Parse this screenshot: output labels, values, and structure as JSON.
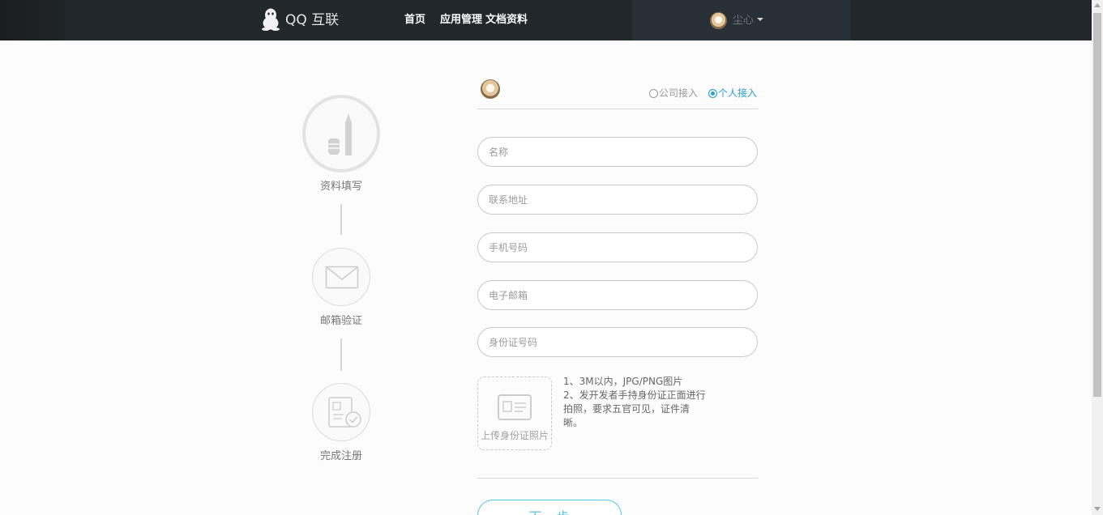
{
  "colors": {
    "header_bg": "#22272b",
    "accent_blue": "#2aa1d3",
    "button_cyan": "#52c7df",
    "step_border": "#e3e3e3"
  },
  "header": {
    "logo_icon": "qq-penguin-icon",
    "logo_text": "QQ 互联",
    "nav": [
      {
        "label": "首页"
      },
      {
        "label": "应用管理"
      },
      {
        "label": "文档资料"
      }
    ],
    "user": {
      "name": "尘心",
      "menu_icon": "caret-down-icon"
    }
  },
  "steps": [
    {
      "label": "资料填写",
      "icon": "pen-eraser-icon",
      "active": true
    },
    {
      "label": "邮箱验证",
      "icon": "envelope-icon",
      "active": false
    },
    {
      "label": "完成注册",
      "icon": "id-card-check-icon",
      "active": false
    }
  ],
  "form": {
    "access_type": [
      {
        "label": "公司接入",
        "selected": false
      },
      {
        "label": "个人接入",
        "selected": true
      }
    ],
    "fields": [
      {
        "placeholder": "名称"
      },
      {
        "placeholder": "联系地址"
      },
      {
        "placeholder": "手机号码"
      },
      {
        "placeholder": "电子邮箱"
      },
      {
        "placeholder": "身份证号码"
      }
    ],
    "upload": {
      "icon": "id-card-icon",
      "label": "上传身份证照片",
      "notes": [
        "1、3M以内，JPG/PNG图片",
        "2、发开发者手持身份证正面进行",
        "拍照，要求五官可见，证件清",
        "晰。"
      ]
    },
    "submit_label": "下一步"
  }
}
